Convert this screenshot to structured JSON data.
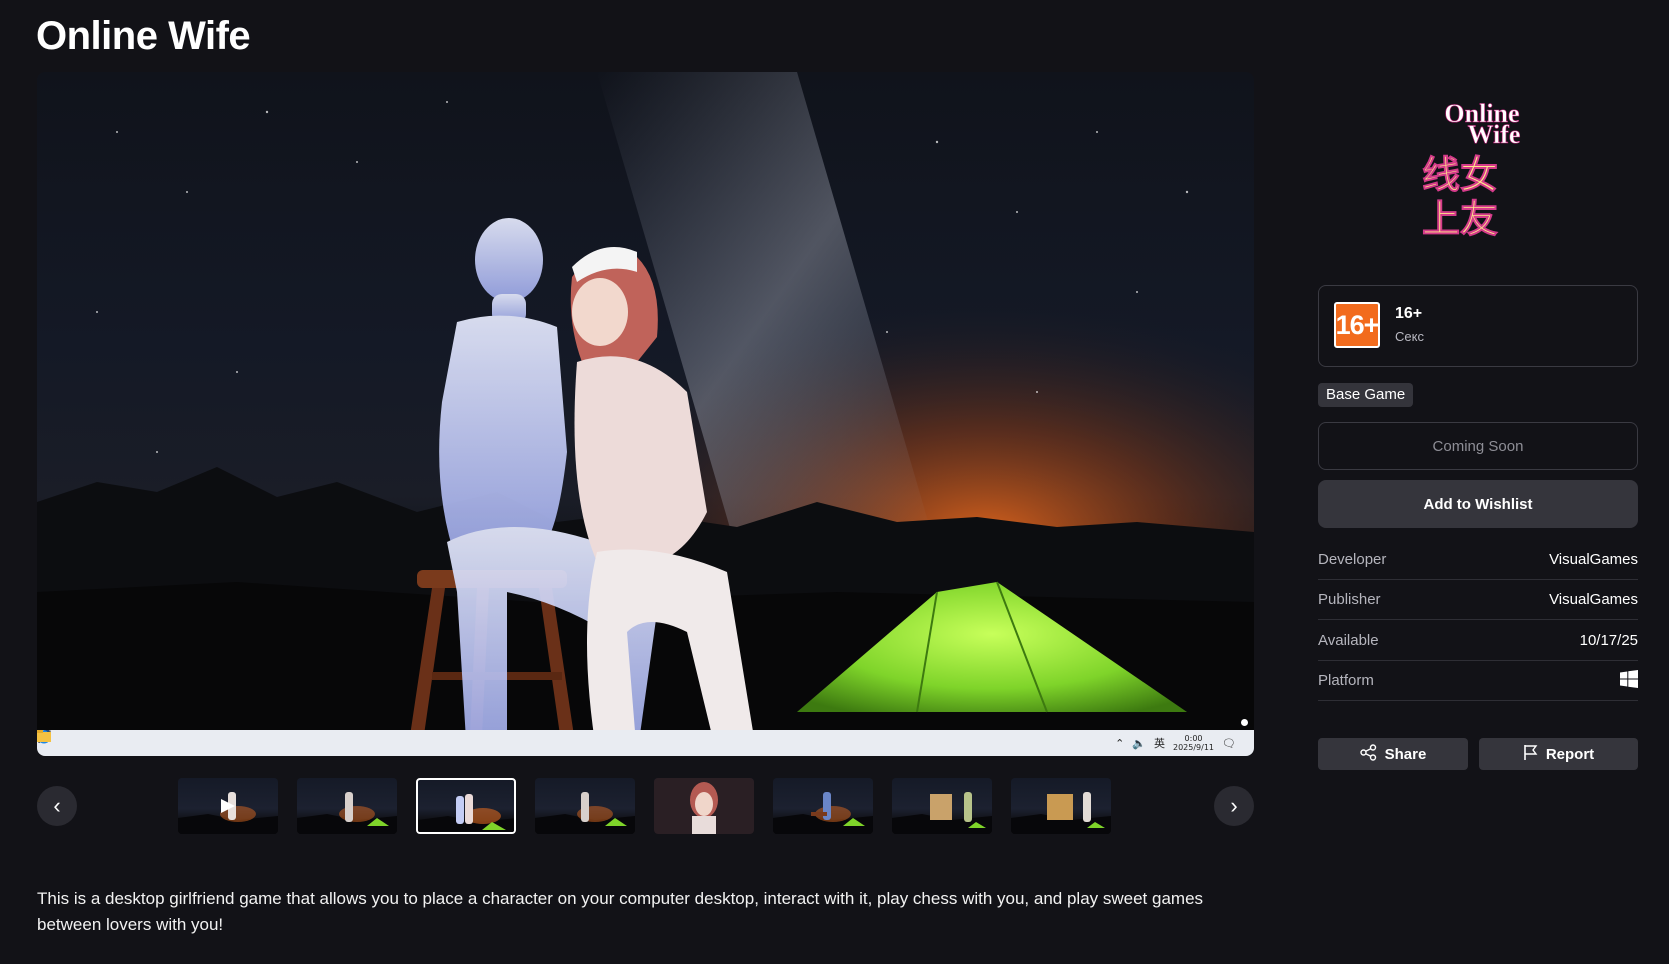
{
  "game": {
    "title": "Online Wife",
    "description": "This is a desktop girlfriend game that allows you to place a character on your computer desktop, interact with it, play chess with you, and play sweet games between lovers with you!"
  },
  "media": {
    "taskbar_clock": "0:00",
    "taskbar_date": "2025/9/11",
    "taskbar_lang": "英",
    "thumbnails": [
      {
        "label": "thumbnail-1",
        "is_video": true
      },
      {
        "label": "thumbnail-2"
      },
      {
        "label": "thumbnail-3",
        "selected": true
      },
      {
        "label": "thumbnail-4"
      },
      {
        "label": "thumbnail-5"
      },
      {
        "label": "thumbnail-6"
      },
      {
        "label": "thumbnail-7"
      },
      {
        "label": "thumbnail-8"
      }
    ],
    "prev_icon": "chevron-left-icon",
    "next_icon": "chevron-right-icon"
  },
  "sidebar": {
    "logo_en_line1": "Online",
    "logo_en_line2": "Wife",
    "logo_cn_line1": "线女",
    "logo_cn_line2": "上友",
    "rating": {
      "badge": "16+",
      "label": "16+",
      "descriptor": "Секс",
      "badge_color": "#f26b1d"
    },
    "type_badge": "Base Game",
    "coming_soon_label": "Coming Soon",
    "wishlist_label": "Add to Wishlist",
    "info": [
      {
        "key": "Developer",
        "value": "VisualGames"
      },
      {
        "key": "Publisher",
        "value": "VisualGames"
      },
      {
        "key": "Available",
        "value": "10/17/25"
      },
      {
        "key": "Platform",
        "value": "",
        "icon": "windows-icon"
      }
    ],
    "share_label": "Share",
    "report_label": "Report"
  },
  "colors": {
    "background": "#121217",
    "button": "#35353c",
    "tent_green": "#8ee63a",
    "horizon_orange": "#d9671f"
  }
}
